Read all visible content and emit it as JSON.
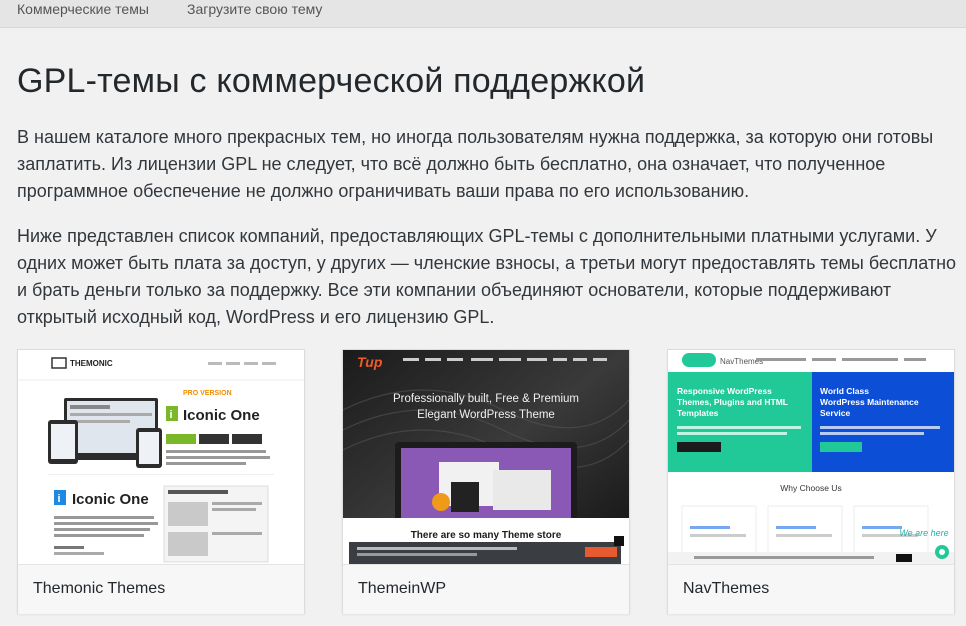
{
  "nav": {
    "tabs": [
      {
        "label": "Коммерческие темы"
      },
      {
        "label": "Загрузите свою тему"
      }
    ]
  },
  "page": {
    "title": "GPL-темы с коммерческой поддержкой",
    "paragraphs": [
      "В нашем каталоге много прекрасных тем, но иногда пользователям нужна поддержка, за которую они готовы заплатить. Из лицензии GPL не следует, что всё должно быть бесплатно, она означает, что полученное программное обеспечение не должно ограничивать ваши права по его использованию.",
      "Ниже представлен список компаний, предоставляющих GPL-темы с дополнительными платными услугами. У одних может быть плата за доступ, у других — членские взносы, а третьи могут предоставлять темы бесплатно и брать деньги только за поддержку. Все эти компании объединяют основатели, которые поддерживают открытый исходный код, WordPress и его лицензию GPL."
    ]
  },
  "cards": [
    {
      "name": "Themonic Themes",
      "shot": {
        "logo": "THEMONIC",
        "badge": "PRO VERSION",
        "product": "Iconic One",
        "product2": "Iconic One"
      }
    },
    {
      "name": "ThemeinWP",
      "shot": {
        "logo": "Tup",
        "headline1": "Professionally built, Free & Premium",
        "headline2": "Elegant WordPress Theme",
        "banner": "There are so many Theme store"
      }
    },
    {
      "name": "NavThemes",
      "shot": {
        "logo": "NavThemes",
        "left_title1": "Responsive WordPress",
        "left_title2": "Themes, Plugins and HTML",
        "left_title3": "Templates",
        "right_title1": "World Class",
        "right_title2": "WordPress Maintenance",
        "right_title3": "Service",
        "why": "Why Choose Us",
        "chat": "We are here"
      }
    }
  ],
  "colors": {
    "accent_green": "#20c997",
    "nav_blue": "#0c4fd6",
    "pro_orange": "#f08d00",
    "iconic_green": "#7ab829",
    "iconic_blue": "#1e88e5"
  }
}
